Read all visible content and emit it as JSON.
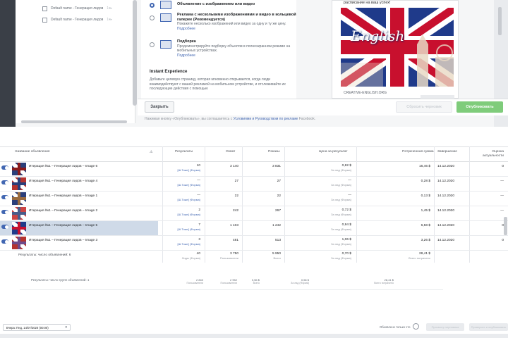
{
  "tree": {
    "items": [
      "Default name - Генерация лидов",
      "Default name - Генерация лидов"
    ],
    "counts": [
      "1▾▸",
      "1▾▸"
    ]
  },
  "formats": [
    {
      "title": "Объявление с изображением или видео",
      "desc": "",
      "link": ""
    },
    {
      "title": "Реклама с несколькими изображениями и видео в кольцевой галерее (Рекомендуется)",
      "desc": "Покажите несколько изображений или видео за одну и ту же цену.",
      "link": "Подробнее"
    },
    {
      "title": "Подборка",
      "desc": "Продемонстрируйте подборку объектов в полноэкранном режиме на мобильных устройствах.",
      "link": "Подробнее"
    }
  ],
  "instant_experience": {
    "title": "Instant Experience",
    "text": "Добавьте целевую страницу, которая мгновенно открывается, когда люди взаимодействуют с вашей рекламой на мобильном устройстве, и отслеживайте их последующие действия с помощью"
  },
  "preview": {
    "caption": "расписание на ваш успех!",
    "domain": "CREATIVE-ENGLISH.ORG",
    "brand_word": "English"
  },
  "footer": {
    "close_label": "Закрыть",
    "draft_label": "Сбросить черновик",
    "publish_label": "Опубликовать",
    "legal_prefix": "Нажимая кнопку «Опубликовать», вы соглашаетесь с ",
    "legal_link": "Условиями и Руководством по рекламе",
    "legal_suffix": " Facebook."
  },
  "table": {
    "headers": {
      "name": "Название объявления",
      "results": "Результаты",
      "reach": "Охват",
      "impressions": "Показы",
      "cost_per_result": "Цена за результат",
      "spent": "Потраченная сумма",
      "ends": "Завершение",
      "relevance": "Оценка актуальности"
    },
    "rows": [
      {
        "name": "Итерация №1 – Генерация лидов – Image 6",
        "results": "10",
        "results_sub": "[Ш.Тоже] (Форма)",
        "reach": "3 140",
        "impressions": "3 831",
        "cpr": "0,82 $",
        "cpr_sub": "За лид (Форма)",
        "spent": "16,46 $",
        "ends": "14.12.2020",
        "rel": "0",
        "selected": false
      },
      {
        "name": "Итерация №1 – Генерация лидов – Image 4",
        "results": "—",
        "results_sub": "[Ш.Тоже] (Форма)",
        "reach": "27",
        "impressions": "27",
        "cpr": "—",
        "cpr_sub": "За лид (Форма)",
        "spent": "0,28 $",
        "ends": "14.12.2020",
        "rel": "—",
        "selected": false
      },
      {
        "name": "Итерация №1 – Генерация лидов – Image 1",
        "results": "—",
        "results_sub": "[Ш.Тоже] (Форма)",
        "reach": "22",
        "impressions": "22",
        "cpr": "—",
        "cpr_sub": "За лид (Форма)",
        "spent": "0,13 $",
        "ends": "14.12.2020",
        "rel": "—",
        "selected": false
      },
      {
        "name": "Итерация №1 – Генерация лидов – Image 2",
        "results": "2",
        "results_sub": "[Ш.Тоже] (Форма)",
        "reach": "242",
        "impressions": "267",
        "cpr": "0,72 $",
        "cpr_sub": "За лид (Форма)",
        "spent": "1,45 $",
        "ends": "14.12.2020",
        "rel": "—",
        "selected": false
      },
      {
        "name": "Итерация №1 – Генерация лидов – Image 5",
        "results": "7",
        "results_sub": "[Ш.Тоже] (Форма)",
        "reach": "1 103",
        "impressions": "1 242",
        "cpr": "0,94 $",
        "cpr_sub": "За лид (Форма)",
        "spent": "6,58 $",
        "ends": "14.12.2020",
        "rel": "0",
        "selected": true
      },
      {
        "name": "Итерация №1 – Генерация лидов – Image 3",
        "results": "3",
        "results_sub": "[Ш.Тоже] (Форма)",
        "reach": "481",
        "impressions": "513",
        "cpr": "1,06 $",
        "cpr_sub": "За лид (Форма)",
        "spent": "3,26 $",
        "ends": "14.12.2020",
        "rel": "0",
        "selected": false
      }
    ],
    "totals": {
      "label": "Результаты: число объявлений: 6",
      "results": "40",
      "results_sub": "Лиды (Форма)",
      "reach": "3 750",
      "reach_sub": "Пользователи",
      "impressions": "5 950",
      "impressions_sub": "Всего",
      "cpr": "0,70 $",
      "cpr_sub": "За лид (Форма)",
      "spent": "28,41 $",
      "spent_sub": "Всего потрачено"
    }
  },
  "summary2": {
    "label": "Результаты: число групп объявлений: 1",
    "values": [
      "2 840",
      "2 952",
      "0,56 $",
      "0,56 $",
      "28,41 $"
    ],
    "subs": [
      "Пользователи",
      "Пользователи",
      "Всего",
      "За лид (Форма)",
      "Всего потрачено"
    ]
  },
  "bottom": {
    "date_label": "Вчера: Пнд, 14/07/2020 (00:00)",
    "status": "Обновлено только что",
    "btn1": "Просмотр черновика",
    "btn2": "Проверить и опубликовать"
  },
  "colors": {
    "accent": "#4267b2",
    "publish_green": "#7fcc7b",
    "selected_row": "#cfdae8"
  }
}
